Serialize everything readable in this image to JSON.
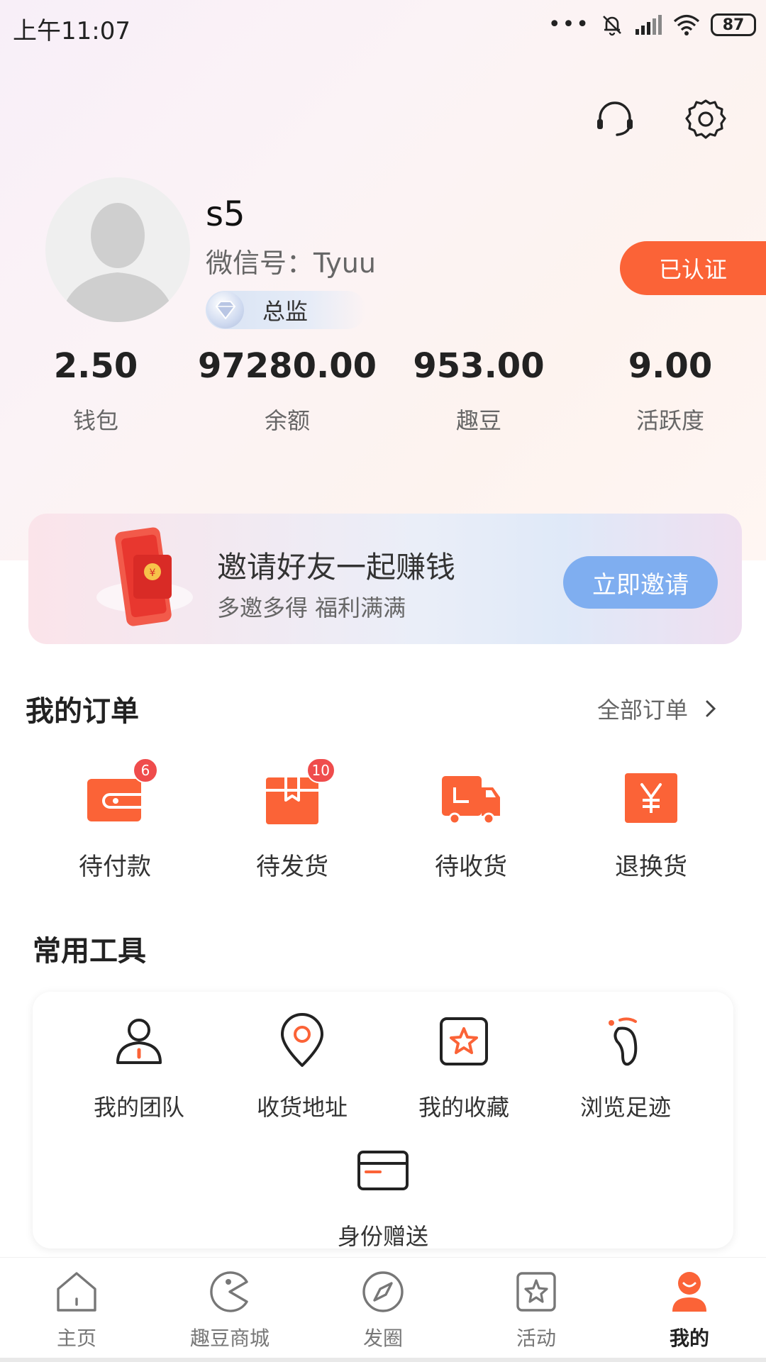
{
  "status_bar": {
    "time": "上午11:07",
    "dots": "•••",
    "battery": "87"
  },
  "profile": {
    "username": "s5",
    "wechat": "微信号：Tyuu",
    "level": "总监",
    "verified_label": "已认证"
  },
  "stats": [
    {
      "value": "2.50",
      "label": "钱包"
    },
    {
      "value": "97280.00",
      "label": "余额"
    },
    {
      "value": "953.00",
      "label": "趣豆"
    },
    {
      "value": "9.00",
      "label": "活跃度"
    }
  ],
  "invite": {
    "title": "邀请好友一起赚钱",
    "subtitle": "多邀多得 福利满满",
    "button": "立即邀请"
  },
  "orders": {
    "title": "我的订单",
    "all_label": "全部订单",
    "items": [
      {
        "label": "待付款",
        "badge": "6"
      },
      {
        "label": "待发货",
        "badge": "10"
      },
      {
        "label": "待收货",
        "badge": ""
      },
      {
        "label": "退换货",
        "badge": ""
      }
    ]
  },
  "tools": {
    "title": "常用工具",
    "items": [
      {
        "label": "我的团队"
      },
      {
        "label": "收货地址"
      },
      {
        "label": "我的收藏"
      },
      {
        "label": "浏览足迹"
      },
      {
        "label": "身份赠送"
      }
    ]
  },
  "bottom_nav": {
    "items": [
      {
        "label": "主页"
      },
      {
        "label": "趣豆商城"
      },
      {
        "label": "发圈"
      },
      {
        "label": "活动"
      },
      {
        "label": "我的"
      }
    ],
    "active": "我的"
  },
  "colors": {
    "accent": "#fb6337",
    "invite_button": "#7faef0",
    "badge": "#ef4c4c"
  }
}
